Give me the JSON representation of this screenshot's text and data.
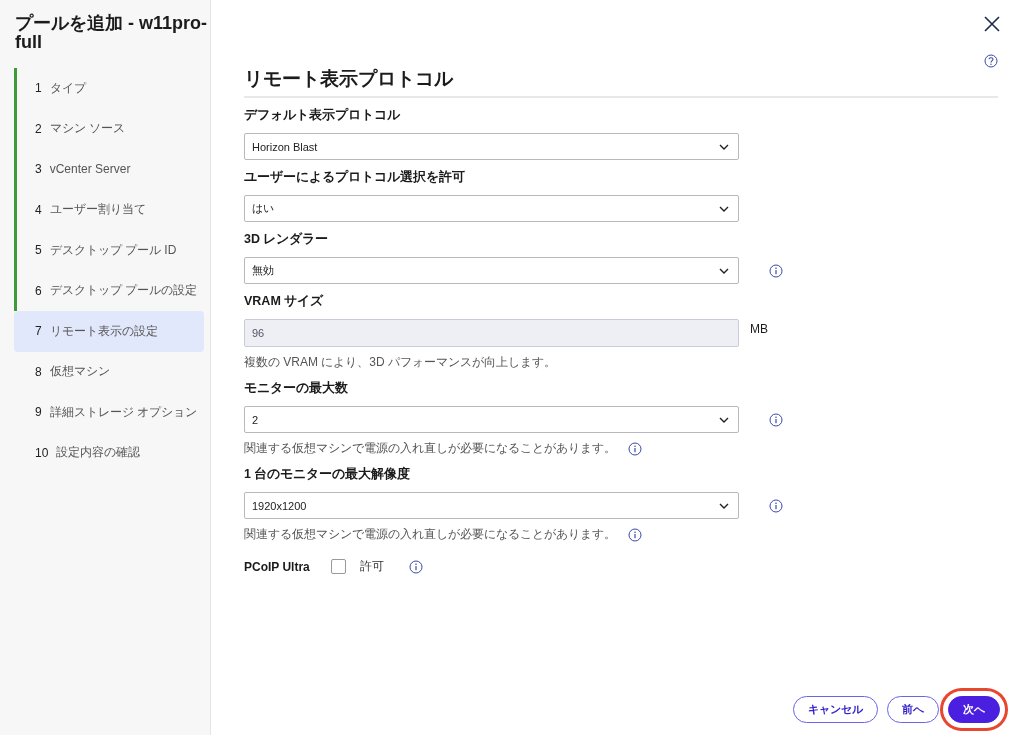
{
  "sidebar": {
    "title": "プールを追加 - w11pro-full",
    "steps": [
      {
        "number": "1",
        "label": "タイプ",
        "completed": true,
        "selected": false
      },
      {
        "number": "2",
        "label": "マシン ソース",
        "completed": true,
        "selected": false
      },
      {
        "number": "3",
        "label": "vCenter Server",
        "completed": true,
        "selected": false
      },
      {
        "number": "4",
        "label": "ユーザー割り当て",
        "completed": true,
        "selected": false
      },
      {
        "number": "5",
        "label": "デスクトップ プール ID",
        "completed": true,
        "selected": false
      },
      {
        "number": "6",
        "label": "デスクトップ プールの設定",
        "completed": true,
        "selected": false
      },
      {
        "number": "7",
        "label": "リモート表示の設定",
        "completed": false,
        "selected": true
      },
      {
        "number": "8",
        "label": "仮想マシン",
        "completed": false,
        "selected": false
      },
      {
        "number": "9",
        "label": "詳細ストレージ オプション",
        "completed": false,
        "selected": false
      },
      {
        "number": "10",
        "label": "設定内容の確認",
        "completed": false,
        "selected": false
      }
    ]
  },
  "main": {
    "heading": "リモート表示プロトコル",
    "fields": [
      {
        "kind": "select",
        "label": "デフォルト表示プロトコル",
        "value": "Horizon Blast",
        "info": false
      },
      {
        "kind": "select",
        "label": "ユーザーによるプロトコル選択を許可",
        "value": "はい",
        "info": false
      },
      {
        "kind": "select",
        "label": "3D レンダラー",
        "value": "無効",
        "info": true
      },
      {
        "kind": "input",
        "label": "VRAM サイズ",
        "value": "96",
        "disabled": true,
        "unit": "MB",
        "help": "複数の VRAM により、3D パフォーマンスが向上します。",
        "help_info": false
      },
      {
        "kind": "select",
        "label": "モニターの最大数",
        "value": "2",
        "info": true,
        "help": "関連する仮想マシンで電源の入れ直しが必要になることがあります。",
        "help_info": true
      },
      {
        "kind": "select",
        "label": "1 台のモニターの最大解像度",
        "value": "1920x1200",
        "info": true,
        "help": "関連する仮想マシンで電源の入れ直しが必要になることがあります。",
        "help_info": true
      },
      {
        "kind": "checkbox",
        "label": "PCoIP Ultra",
        "option": "許可",
        "checked": false,
        "info": true
      }
    ]
  },
  "footer": {
    "buttons": [
      {
        "kind": "outline",
        "label": "キャンセル",
        "highlighted": false
      },
      {
        "kind": "outline",
        "label": "前へ",
        "highlighted": false
      },
      {
        "kind": "primary",
        "label": "次へ",
        "highlighted": true
      }
    ]
  }
}
